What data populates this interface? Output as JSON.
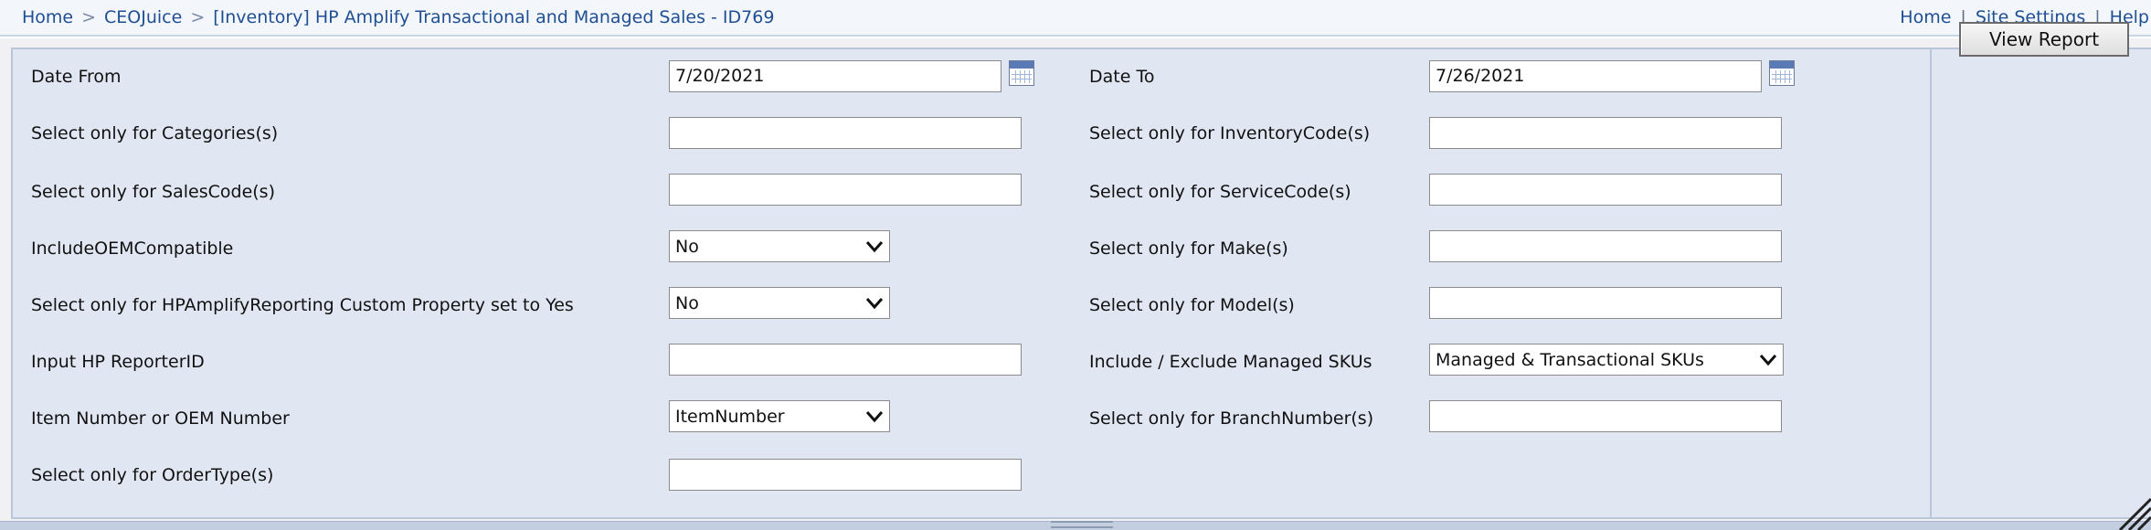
{
  "breadcrumb": {
    "home": "Home",
    "separator": ">",
    "ceojuice": "CEOJuice",
    "report": "[Inventory] HP Amplify Transactional and Managed Sales - ID769"
  },
  "toplinks": {
    "home": "Home",
    "site_settings": "Site Settings",
    "help": "Help",
    "separator": "|"
  },
  "params": {
    "date_from": {
      "label": "Date From",
      "value": "7/20/2021"
    },
    "date_to": {
      "label": "Date To",
      "value": "7/26/2021"
    },
    "categories": {
      "label": "Select only for Categories(s)",
      "value": ""
    },
    "inventory_codes": {
      "label": "Select only for InventoryCode(s)",
      "value": ""
    },
    "sales_codes": {
      "label": "Select only for SalesCode(s)",
      "value": ""
    },
    "service_codes": {
      "label": "Select only for ServiceCode(s)",
      "value": ""
    },
    "include_oem_compatible": {
      "label": "IncludeOEMCompatible",
      "value": "No"
    },
    "makes": {
      "label": "Select only for Make(s)",
      "value": ""
    },
    "hp_amplify_reporting": {
      "label": "Select only for HPAmplifyReporting Custom Property set to Yes",
      "value": "No"
    },
    "models": {
      "label": "Select only for Model(s)",
      "value": ""
    },
    "hp_reporter_id": {
      "label": "Input HP ReporterID",
      "value": ""
    },
    "managed_skus": {
      "label": "Include / Exclude Managed SKUs",
      "value": "Managed & Transactional SKUs"
    },
    "item_or_oem": {
      "label": "Item Number or OEM Number",
      "value": "ItemNumber"
    },
    "branch_numbers": {
      "label": "Select only for BranchNumber(s)",
      "value": ""
    },
    "order_types": {
      "label": "Select only for OrderType(s)",
      "value": ""
    }
  },
  "view_report_label": "View Report",
  "colors": {
    "link": "#1f4f93",
    "panel": "#e1e7f2",
    "border": "#b9c6da"
  },
  "icons": {
    "calendar": "calendar-icon",
    "dropdown": "chevron-down-icon",
    "resize": "resize-grip-icon"
  }
}
